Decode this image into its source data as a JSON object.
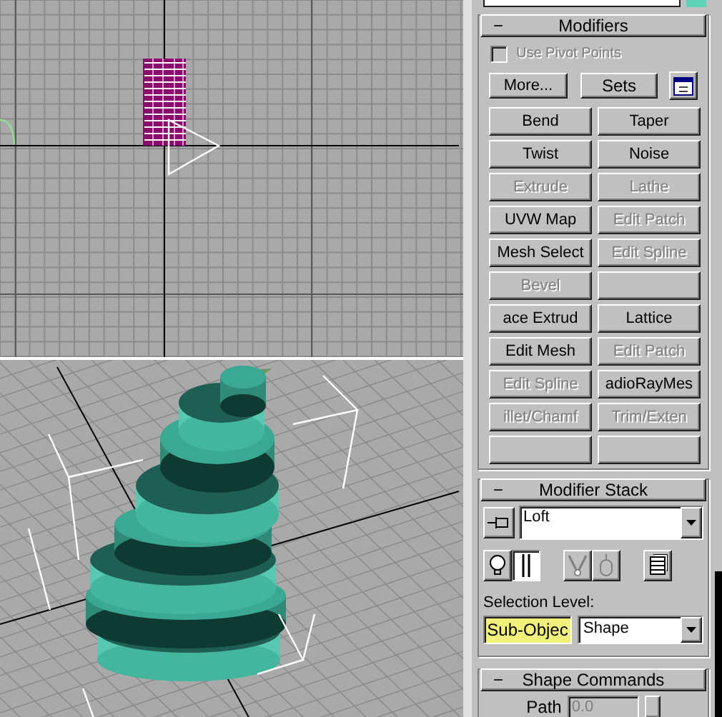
{
  "object_name": {
    "color": "#5fd3b8"
  },
  "modifiers": {
    "title": "Modifiers",
    "collapse_sign": "−",
    "use_pivot_points": {
      "label": "Use Pivot Points",
      "checked": false,
      "disabled": true
    },
    "more_button": "More...",
    "sets_button": "Sets",
    "buttons": [
      {
        "kind": "command",
        "label": "Bend",
        "disabled": false
      },
      {
        "kind": "command",
        "label": "Taper",
        "disabled": false
      },
      {
        "kind": "command",
        "label": "Twist",
        "disabled": false
      },
      {
        "kind": "command",
        "label": "Noise",
        "disabled": false
      },
      {
        "kind": "command",
        "label": "Extrude",
        "disabled": true
      },
      {
        "kind": "command",
        "label": "Lathe",
        "disabled": true
      },
      {
        "kind": "command",
        "label": "UVW Map",
        "disabled": false
      },
      {
        "kind": "command",
        "label": "Edit Patch",
        "disabled": true
      },
      {
        "kind": "command",
        "label": "Mesh Select",
        "disabled": false
      },
      {
        "kind": "command",
        "label": "Edit Spline",
        "disabled": true
      },
      {
        "kind": "command",
        "label": "Bevel",
        "disabled": true
      },
      {
        "kind": "blank"
      },
      {
        "kind": "command",
        "label": "ace Extrud",
        "disabled": false
      },
      {
        "kind": "command",
        "label": "Lattice",
        "disabled": false
      },
      {
        "kind": "command",
        "label": "Edit Mesh",
        "disabled": false
      },
      {
        "kind": "command",
        "label": "Edit Patch",
        "disabled": true
      },
      {
        "kind": "command",
        "label": "Edit Spline",
        "disabled": true
      },
      {
        "kind": "command",
        "label": "adioRayMes",
        "disabled": false
      },
      {
        "kind": "command",
        "label": "illet/Chamf",
        "disabled": true
      },
      {
        "kind": "command",
        "label": "Trim/Exten",
        "disabled": true
      },
      {
        "kind": "blank"
      },
      {
        "kind": "blank"
      }
    ]
  },
  "modifier_stack": {
    "title": "Modifier Stack",
    "collapse_sign": "−",
    "current": "Loft",
    "tools": [
      {
        "kind": "bulb",
        "disabled": false,
        "pressed": false
      },
      {
        "kind": "ibeam",
        "disabled": false,
        "pressed": true
      },
      {
        "kind": "fork",
        "disabled": true,
        "pressed": false
      },
      {
        "kind": "mouse",
        "disabled": true,
        "pressed": false
      },
      {
        "kind": "stack",
        "disabled": false,
        "pressed": false
      }
    ],
    "selection_level_label": "Selection Level:",
    "sub_object": {
      "label": "Sub-Objec",
      "on": true
    },
    "level": "Shape"
  },
  "shape_commands": {
    "title": "Shape Commands",
    "collapse_sign": "−",
    "path_label": "Path",
    "path_value": "0.0",
    "path_disabled": true
  }
}
